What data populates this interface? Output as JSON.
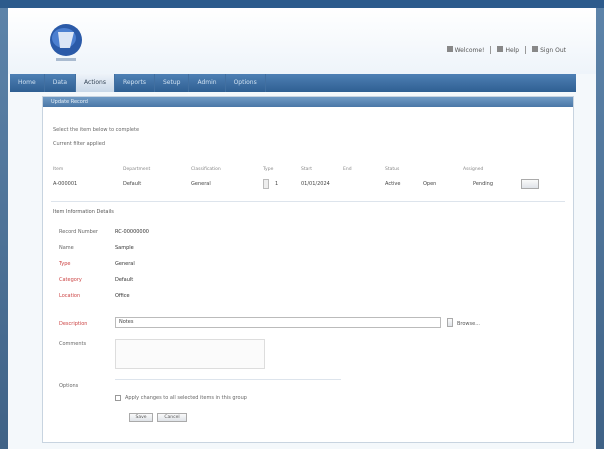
{
  "header": {
    "links": [
      "Welcome!",
      "Help",
      "Sign Out"
    ]
  },
  "nav": {
    "tabs": [
      "Home",
      "Data",
      "Actions",
      "Reports",
      "Setup",
      "Admin",
      "Options"
    ],
    "active_index": 2
  },
  "panel": {
    "title": "Update Record",
    "line1": "Select the item below to complete",
    "line2": "Current filter applied",
    "columns": [
      "Item",
      "Department",
      "Classification",
      "Type",
      "Start",
      "End",
      "Status",
      "Assigned"
    ],
    "values": [
      "A-000001",
      "Default",
      "General",
      "1",
      "01/01/2024",
      "Active",
      "Open",
      "Pending"
    ],
    "section": "Item Information Details",
    "fields": [
      {
        "label": "Record Number",
        "value": "RC-00000000",
        "required": false
      },
      {
        "label": "Name",
        "value": "Sample",
        "required": false
      },
      {
        "label": "Type",
        "value": "General",
        "required": true
      },
      {
        "label": "Category",
        "value": "Default",
        "required": true
      },
      {
        "label": "Location",
        "value": "Office",
        "required": true
      }
    ],
    "input_label": "Description",
    "input_value": "Notes",
    "lookup_button": "Browse...",
    "comments_label": "Comments",
    "options_label": "Options",
    "checkbox_text": "Apply changes to all selected items in this group",
    "small_link": "Save",
    "small_link2": "Cancel"
  },
  "colors": {
    "nav": "#2f5f92",
    "accent": "#4a77a6",
    "required": "#cc4444"
  }
}
